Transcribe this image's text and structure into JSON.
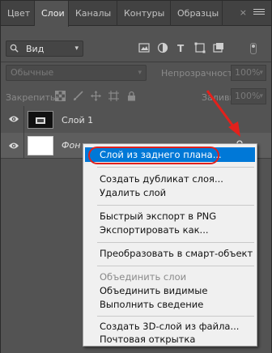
{
  "tabs": [
    {
      "label": "Цвет",
      "active": false
    },
    {
      "label": "Слои",
      "active": true
    },
    {
      "label": "Каналы",
      "active": false
    },
    {
      "label": "Контуры",
      "active": false
    },
    {
      "label": "Образцы",
      "active": false
    }
  ],
  "tab_close": "×",
  "filter": {
    "label": "Вид",
    "caret": "▾"
  },
  "blend_mode": {
    "value": "Обычные",
    "caret": "▾"
  },
  "opacity": {
    "label": "Непрозрачность:",
    "value": "100%",
    "caret": "▾"
  },
  "lock": {
    "label": "Закрепить:"
  },
  "fill": {
    "label": "Заливка:",
    "value": "100%",
    "caret": "▾"
  },
  "layers": [
    {
      "name": "Слой 1"
    },
    {
      "name": "Фон"
    }
  ],
  "context_menu": {
    "items": [
      {
        "label": "Слой из заднего плана...",
        "highlighted": true
      },
      {
        "label": "Создать дубликат слоя..."
      },
      {
        "label": "Удалить слой"
      },
      {
        "label": "Быстрый экспорт в PNG"
      },
      {
        "label": "Экспортировать как..."
      },
      {
        "label": "Преобразовать в смарт-объект"
      },
      {
        "label": "Объединить слои",
        "disabled": true
      },
      {
        "label": "Объединить видимые"
      },
      {
        "label": "Выполнить сведение"
      },
      {
        "label": "Создать 3D-слой из файла..."
      },
      {
        "label": "Почтовая открытка"
      }
    ]
  },
  "colors": {
    "panel_bg": "#535353",
    "highlight": "#0078d7",
    "annotation_red": "#e2211c"
  }
}
